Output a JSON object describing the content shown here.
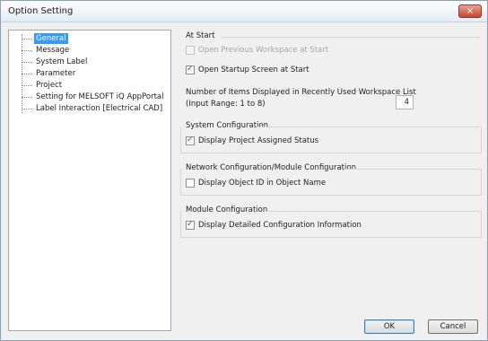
{
  "window": {
    "title": "Option Setting",
    "close_label": "×"
  },
  "tree": {
    "items": [
      {
        "label": "General",
        "selected": true
      },
      {
        "label": "Message"
      },
      {
        "label": "System Label"
      },
      {
        "label": "Parameter"
      },
      {
        "label": "Project"
      },
      {
        "label": "Setting for MELSOFT iQ AppPortal"
      },
      {
        "label": "Label Interaction [Electrical CAD]"
      }
    ]
  },
  "at_start": {
    "title": "At Start",
    "open_previous_workspace": {
      "label": "Open Previous Workspace at Start",
      "checked": false,
      "enabled": false
    },
    "open_startup_screen": {
      "label": "Open Startup Screen at Start",
      "checked": true,
      "enabled": true
    },
    "recent_items_label_line1": "Number of Items Displayed in Recently Used Workspace List",
    "recent_items_label_line2": "(Input Range: 1 to 8)",
    "recent_items_value": "4"
  },
  "system_configuration": {
    "title": "System Configuration",
    "display_project_assigned": {
      "label": "Display Project Assigned Status",
      "checked": true
    }
  },
  "network_configuration": {
    "title": "Network Configuration/Module Configuration",
    "display_object_id": {
      "label": "Display Object ID in Object Name",
      "checked": false
    }
  },
  "module_configuration": {
    "title": "Module Configuration",
    "display_detailed_info": {
      "label": "Display Detailed Configuration Information",
      "checked": true
    }
  },
  "buttons": {
    "ok": "OK",
    "cancel": "Cancel"
  }
}
